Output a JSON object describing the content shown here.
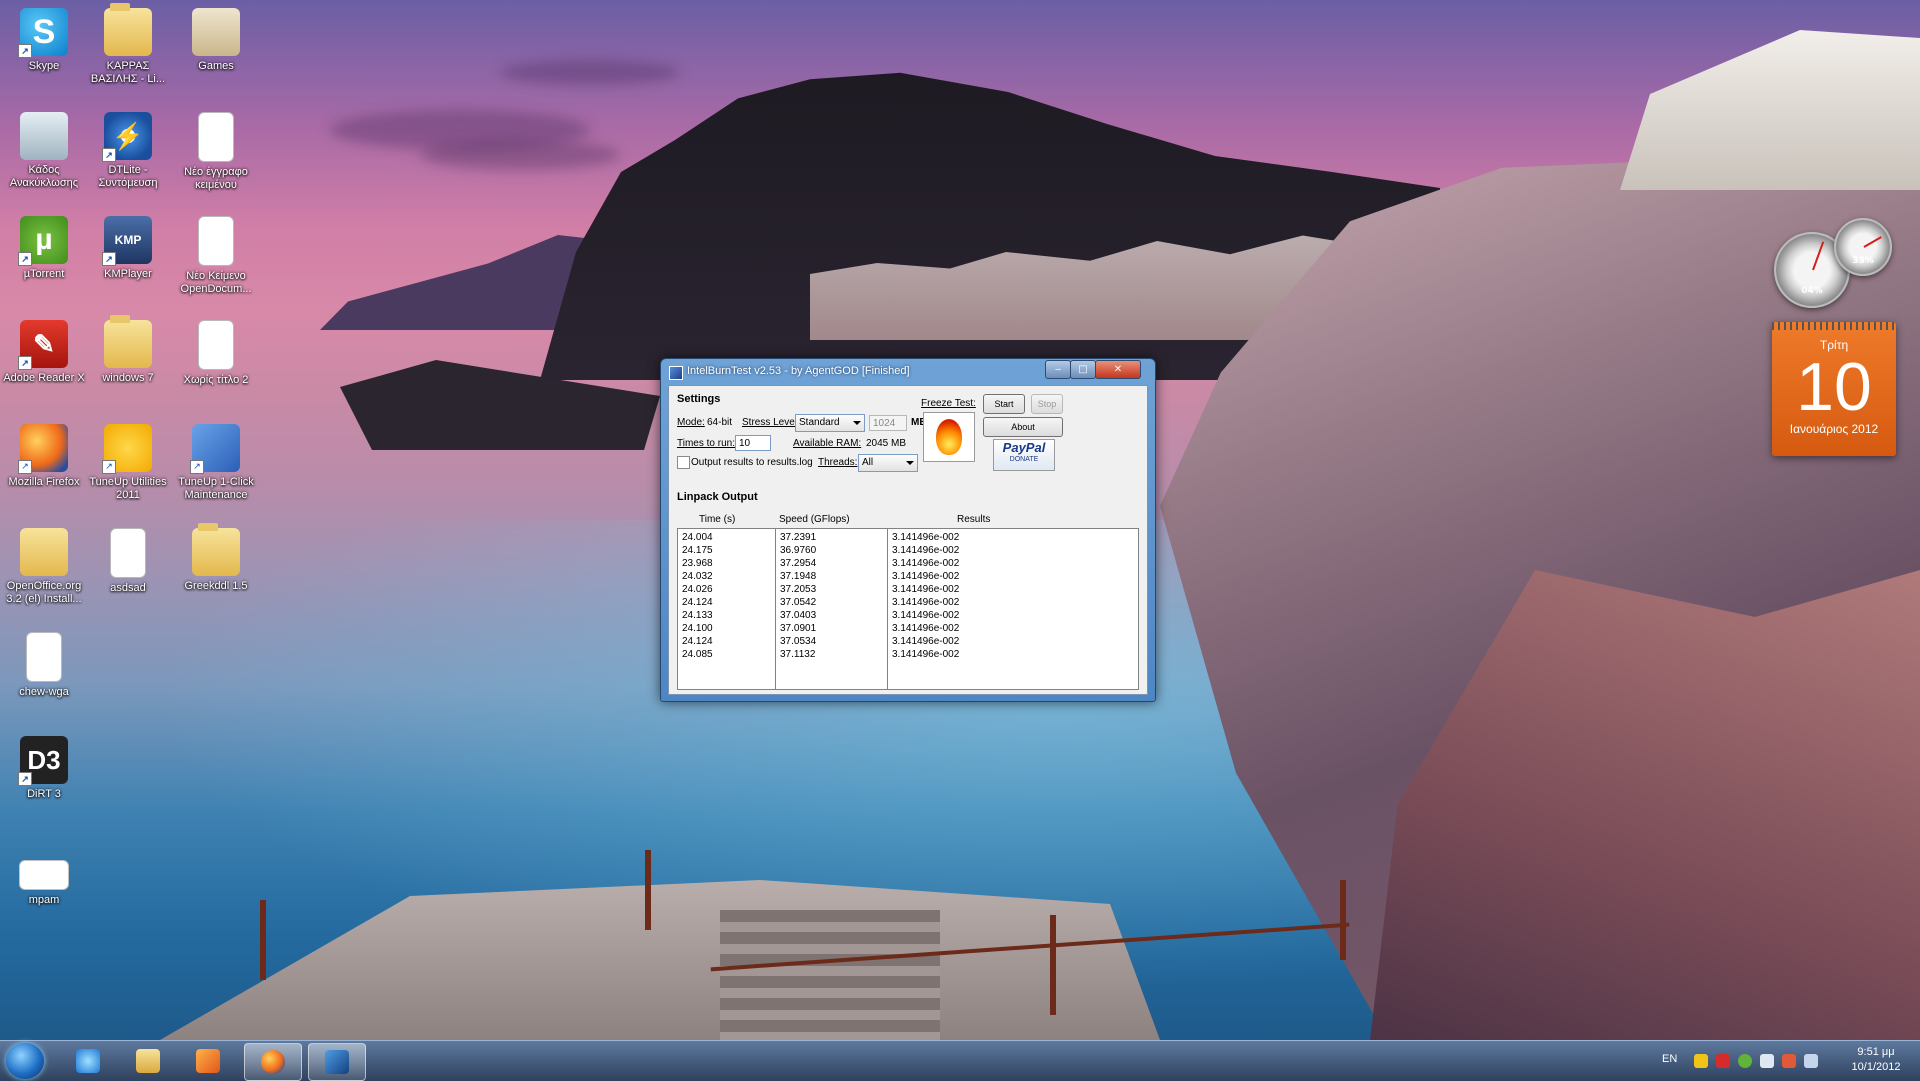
{
  "desktop_icons": [
    {
      "label": "Skype",
      "icon": "skype-icon"
    },
    {
      "label": "ΚΑΡΡΑΣ ΒΑΣΙΛΗΣ - Li...",
      "icon": "folder-icon"
    },
    {
      "label": "Games",
      "icon": "games-folder-icon"
    },
    {
      "label": "Κάδος Ανακύκλωσης",
      "icon": "recycle-bin-icon"
    },
    {
      "label": "DTLite - Συντόμευση",
      "icon": "daemon-tools-icon",
      "glyph": "⚡"
    },
    {
      "label": "Νέο έγγραφο κειμένου",
      "icon": "text-document-icon"
    },
    {
      "label": "µTorrent",
      "icon": "utorrent-icon",
      "glyph": "µ"
    },
    {
      "label": "KMPlayer",
      "icon": "kmplayer-icon",
      "glyph": "KMP"
    },
    {
      "label": "Νέο Κείμενο OpenDocum...",
      "icon": "opendocument-icon"
    },
    {
      "label": "Adobe Reader X",
      "icon": "adobe-reader-icon",
      "glyph": "✎"
    },
    {
      "label": "windows 7",
      "icon": "folder-icon"
    },
    {
      "label": "Χωρίς τίτλο 2",
      "icon": "document-icon"
    },
    {
      "label": "Mozilla Firefox",
      "icon": "firefox-icon"
    },
    {
      "label": "TuneUp Utilities 2011",
      "icon": "tuneup-utilities-icon"
    },
    {
      "label": "TuneUp 1-Click Maintenance",
      "icon": "tuneup-maintenance-icon"
    },
    {
      "label": "OpenOffice.org 3.2 (el) Install...",
      "icon": "folder-icon"
    },
    {
      "label": "asdsad",
      "icon": "document-icon"
    },
    {
      "label": "Greekddl 1.5",
      "icon": "folder-icon"
    },
    {
      "label": "chew-wga",
      "icon": "blank-file-icon"
    },
    {
      "label": "DiRT 3",
      "icon": "dirt3-icon",
      "glyph": "D3"
    },
    {
      "label": "mpam",
      "icon": "blank-file-icon"
    }
  ],
  "gadgets": {
    "cpu_meter": {
      "cpu": "04%",
      "ram": "33%"
    },
    "calendar": {
      "weekday": "Τρίτη",
      "day": "10",
      "month_year": "Ιανουάριος 2012"
    }
  },
  "window": {
    "title": "IntelBurnTest v2.53 - by AgentGOD [Finished]",
    "caption_buttons": {
      "minimize": "‒",
      "maximize": "□",
      "close": "✕"
    },
    "settings": {
      "heading": "Settings",
      "mode_label": "Mode:",
      "mode_value": "64-bit",
      "stress_label": "Stress Level:",
      "stress_value": "Standard",
      "mb_value": "1024",
      "mb_unit": "MB",
      "times_label": "Times to run:",
      "times_value": "10",
      "ram_label": "Available RAM:",
      "ram_value": "2045 MB",
      "threads_label": "Threads:",
      "threads_value": "All",
      "output_checkbox_label": "Output results to results.log",
      "freeze_label": "Freeze Test:"
    },
    "buttons": {
      "start": "Start",
      "stop": "Stop",
      "about": "About",
      "paypal": "PayPal",
      "donate": "DONATE"
    },
    "linpack": {
      "heading": "Linpack Output",
      "columns": [
        "Time (s)",
        "Speed (GFlops)",
        "Results"
      ],
      "rows": [
        [
          "24.004",
          "37.2391",
          "3.141496e-002"
        ],
        [
          "24.175",
          "36.9760",
          "3.141496e-002"
        ],
        [
          "23.968",
          "37.2954",
          "3.141496e-002"
        ],
        [
          "24.032",
          "37.1948",
          "3.141496e-002"
        ],
        [
          "24.026",
          "37.2053",
          "3.141496e-002"
        ],
        [
          "24.124",
          "37.0542",
          "3.141496e-002"
        ],
        [
          "24.133",
          "37.0403",
          "3.141496e-002"
        ],
        [
          "24.100",
          "37.0901",
          "3.141496e-002"
        ],
        [
          "24.124",
          "37.0534",
          "3.141496e-002"
        ],
        [
          "24.085",
          "37.1132",
          "3.141496e-002"
        ]
      ]
    }
  },
  "taskbar": {
    "pinned": [
      {
        "name": "internet-explorer",
        "icon": "ie-icon"
      },
      {
        "name": "windows-explorer",
        "icon": "explorer-icon"
      },
      {
        "name": "media-player",
        "icon": "media-player-icon"
      },
      {
        "name": "firefox",
        "icon": "firefox-icon"
      },
      {
        "name": "intelburntest",
        "icon": "intel-core-icon",
        "active": true
      }
    ],
    "language": "EN",
    "clock_time": "9:51 μμ",
    "clock_date": "10/1/2012"
  }
}
